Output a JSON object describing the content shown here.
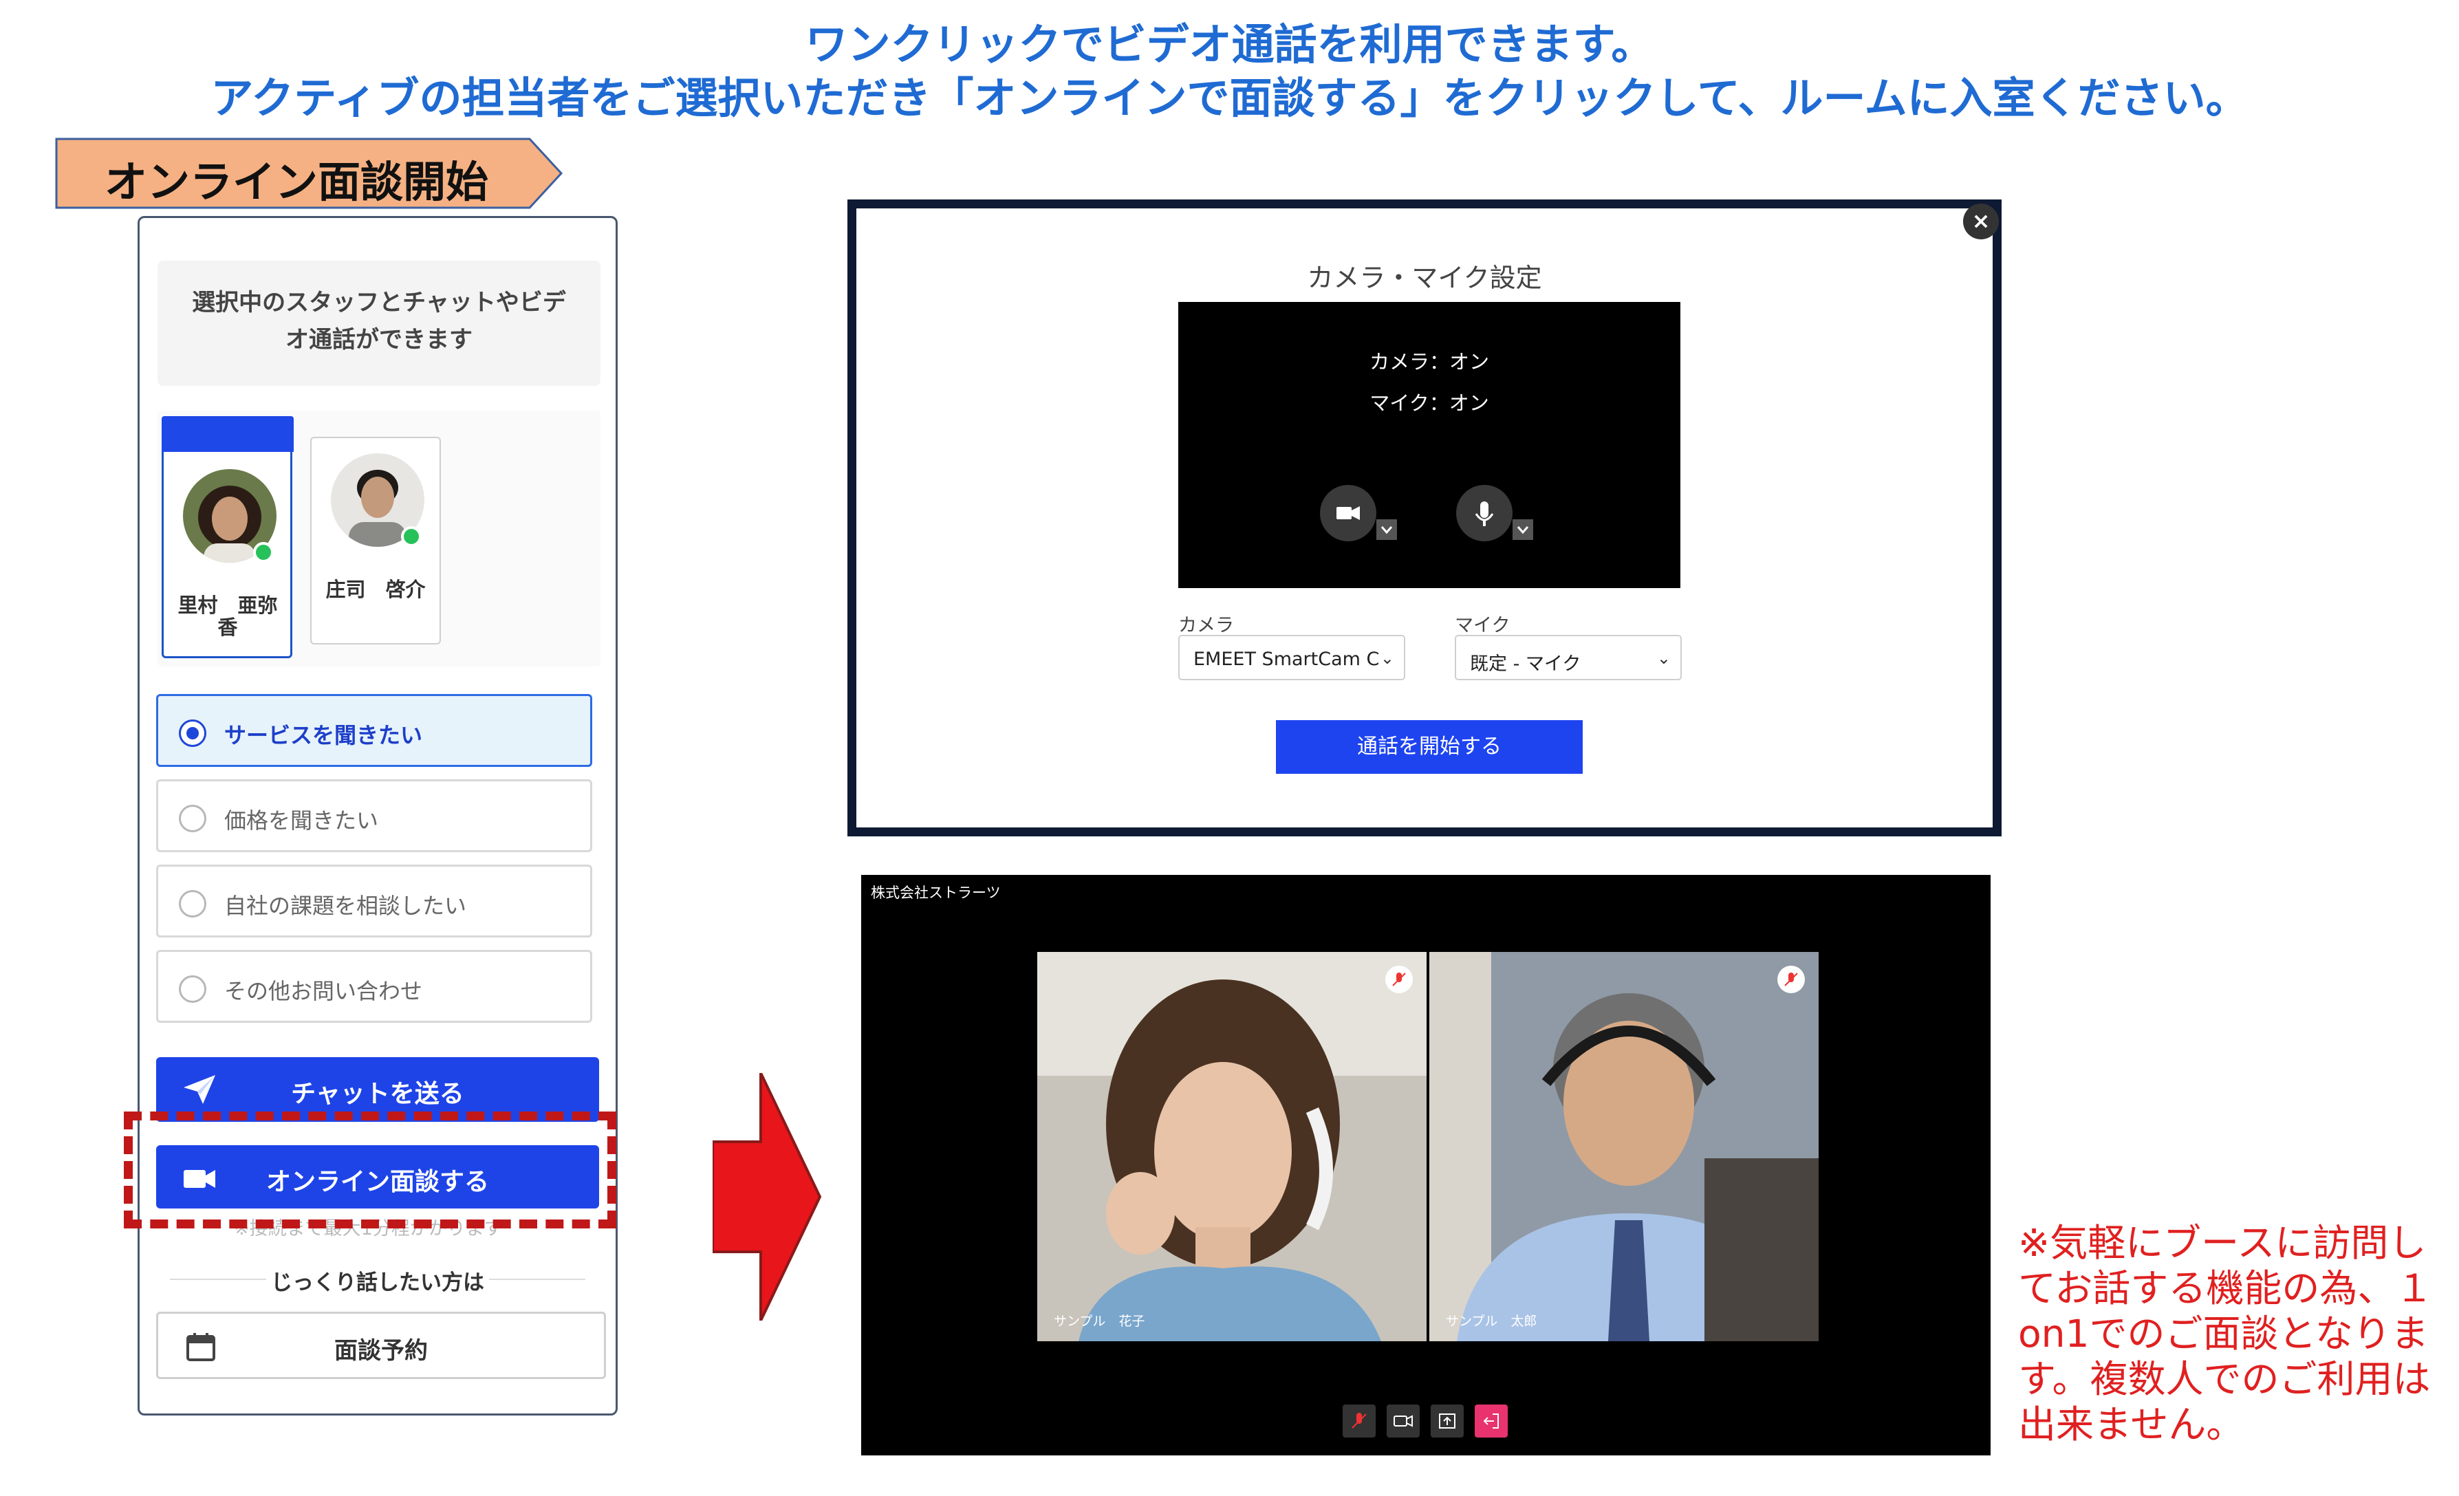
{
  "headline": {
    "line1": "ワンクリックでビデオ通話を利用できます。",
    "line2": "アクティブの担当者をご選択いただき「オンラインで面談する」をクリックして、ルームに入室ください。"
  },
  "section_tag": {
    "label": "オンライン面談開始"
  },
  "widget": {
    "intro_line1": "選択中のスタッフとチャットやビデ",
    "intro_line2": "オ通話ができます",
    "staff": [
      {
        "name_line1": "里村　亜弥",
        "name_line2": "香",
        "selected": true,
        "online": true
      },
      {
        "name_line1": "庄司　啓介",
        "name_line2": "",
        "selected": false,
        "online": true
      }
    ],
    "options": [
      {
        "label": "サービスを聞きたい",
        "selected": true
      },
      {
        "label": "価格を聞きたい",
        "selected": false
      },
      {
        "label": "自社の課題を相談したい",
        "selected": false
      },
      {
        "label": "その他お問い合わせ",
        "selected": false
      }
    ],
    "chat_button": "チャットを送る",
    "online_button": "オンライン面談する",
    "small_note": "※接続まで最大1分程かかります",
    "divider_text": "じっくり話したい方は",
    "reserve_button": "面談予約"
  },
  "camera_dialog": {
    "title": "カメラ・マイク設定",
    "camera_status": "カメラ：オン",
    "mic_status": "マイク：オン",
    "camera_label": "カメラ",
    "camera_value": "EMEET SmartCam C",
    "mic_label": "マイク",
    "mic_value": "既定 - マイク",
    "start_button": "通話を開始する",
    "close_glyph": "×"
  },
  "video_call": {
    "company": "株式会社ストラーツ",
    "participants": [
      {
        "name": "サンプル　花子",
        "muted": true
      },
      {
        "name": "サンプル　太郎",
        "muted": true
      }
    ]
  },
  "side_note": "※気軽にブースに訪問してお話する機能の為、１on1でのご面談となります。複数人でのご利用は出来ません。",
  "colors": {
    "headline": "#1f6bd3",
    "primary_button": "#1e44e8",
    "highlight_dash": "#c01818",
    "arrow": "#e8151b",
    "note": "#e02020",
    "tag_fill": "#f5b183"
  },
  "icons": {
    "chat": "paper-plane-icon",
    "online": "video-camera-icon",
    "reserve": "calendar-icon",
    "camera_toggle": "video-camera-icon",
    "mic_toggle": "microphone-icon"
  }
}
